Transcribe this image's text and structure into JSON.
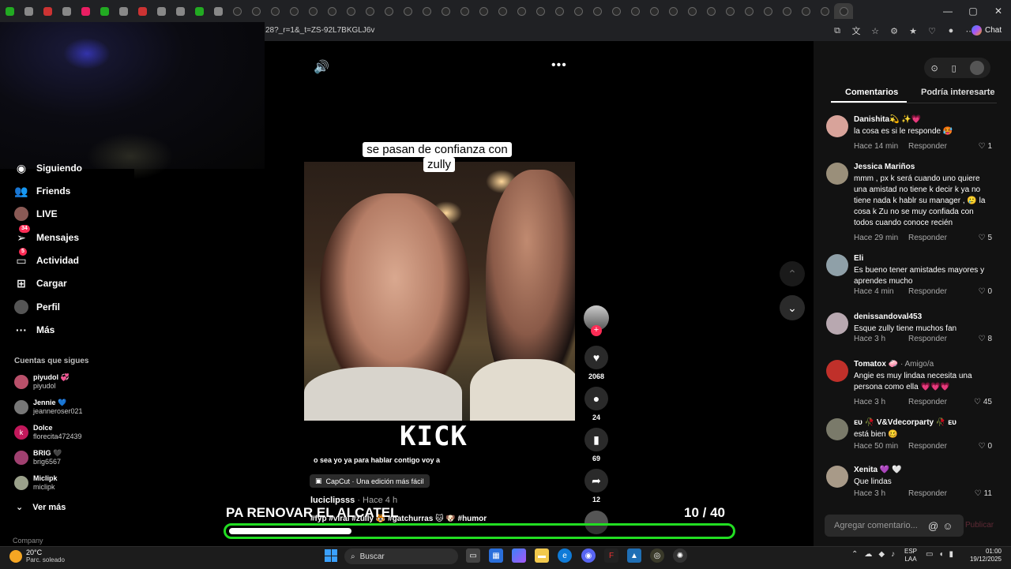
{
  "browser": {
    "url": "28?_r=1&_t=ZS-92L7BKGLJ6v",
    "chat_label": "Chat",
    "window_buttons": [
      "—",
      "▢",
      "✕"
    ]
  },
  "sidebar": {
    "items": [
      {
        "label": "Siguiendo",
        "icon": "following-icon"
      },
      {
        "label": "Friends",
        "icon": "friends-icon"
      },
      {
        "label": "LIVE",
        "icon": "live-icon"
      },
      {
        "label": "Mensajes",
        "icon": "messages-icon",
        "badge": "34"
      },
      {
        "label": "Actividad",
        "icon": "activity-icon",
        "badge": "5"
      },
      {
        "label": "Cargar",
        "icon": "upload-icon"
      },
      {
        "label": "Perfil",
        "icon": "profile-icon"
      },
      {
        "label": "Más",
        "icon": "more-icon"
      }
    ],
    "following_title": "Cuentas que sigues",
    "following": [
      {
        "name": "piyudol",
        "username": "piyudol",
        "emoji": "💞"
      },
      {
        "name": "Jennie",
        "username": "jeanneroser021",
        "emoji": "💙"
      },
      {
        "name": "Dolce",
        "username": "florecita472439",
        "avatar_letter": "k"
      },
      {
        "name": "BRIG",
        "username": "brig6567",
        "emoji": "🖤"
      },
      {
        "name": "Miclipk",
        "username": "miclipk"
      }
    ],
    "see_more": "Ver más",
    "company": "Company"
  },
  "video": {
    "caption": "se pasan de confianza con zully",
    "kick_text": "KICK",
    "subtitle": "o sea yo ya para hablar contigo voy a",
    "capcut": "CapCut · Una edición más fácil",
    "author": "luciclipsss",
    "time": " · Hace 4 h",
    "hashtags": "#fyp #viral #zully 🐯 #gatchurras 🐱 🐶 #humor"
  },
  "actions": {
    "likes": "2068",
    "comments": "24",
    "saves": "69",
    "shares": "12"
  },
  "overlay": {
    "left_text": "PA RENOVAR EL ALCATEL",
    "counter": "10  / 40",
    "progress": 0.245
  },
  "panel": {
    "tab_comments": "Comentarios",
    "tab_interest": "Podría interesarte",
    "reply_label": "Responder",
    "comments": [
      {
        "name": "Danishita💫 ✨💗",
        "text": "la cosa es si le responde 🥵",
        "time": "Hace 14 min",
        "likes": "1",
        "color": "#d8a39a"
      },
      {
        "name": "Jessica Mariños",
        "text": "mmm , px k será cuando uno quiere una amistad no tiene k decir k ya no tiene nada k hablr su manager , 🥲 la cosa k Zu no se muy confiada con todos cuando conoce recién",
        "time": "Hace 29 min",
        "likes": "5",
        "color": "#9a8f7a"
      },
      {
        "name": "Eli",
        "text": "Es bueno tener amistades mayores y aprendes mucho",
        "time": "Hace 4 min",
        "likes": "0",
        "color": "#8fa0a8"
      },
      {
        "name": "denissandoval453",
        "text": "Esque zully tiene muchos fan",
        "time": "Hace 3 h",
        "likes": "8",
        "color": "#b8a8b0"
      },
      {
        "name": "Tomatox 🧼",
        "tag": " · Amigo/a",
        "text": "Angie es muy lindaa necesita una persona como ella 💗💗💗",
        "time": "Hace 3 h",
        "likes": "45",
        "color": "#c0302a"
      },
      {
        "name": "ᴇᴜ 🥀 V&Vdecorparty 🥀 ᴇᴜ",
        "text": "está bien 🥴",
        "time": "Hace 50 min",
        "likes": "0",
        "color": "#7a7a6a"
      },
      {
        "name": "Xenita 💜 🤍",
        "text": "Que lindas",
        "time": "Hace 3 h",
        "likes": "11",
        "color": "#a89a88"
      }
    ],
    "comment_placeholder": "Agregar comentario...",
    "publish": "Publicar"
  },
  "taskbar": {
    "temp": "20°C",
    "weather": "Parc. soleado",
    "search": "Buscar",
    "lang1": "ESP",
    "lang2": "LAA",
    "time": "01:00",
    "date": "19/12/2025"
  }
}
